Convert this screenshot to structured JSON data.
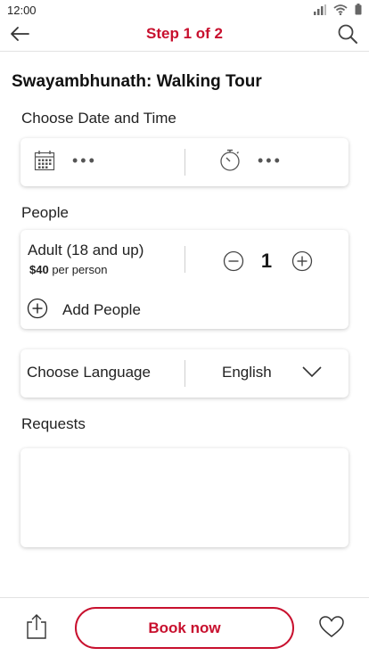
{
  "status_bar": {
    "time": "12:00"
  },
  "header": {
    "title": "Step 1 of 2"
  },
  "tour": {
    "title": "Swayambhunath: Walking Tour"
  },
  "date_time": {
    "label": "Choose Date and Time",
    "date_placeholder": "•••",
    "time_placeholder": "•••"
  },
  "people": {
    "label": "People",
    "adult_label": "Adult (18 and up)",
    "price": "$40",
    "price_suffix": " per person",
    "quantity": "1",
    "add_label": "Add People"
  },
  "language": {
    "label": "Choose Language",
    "value": "English"
  },
  "requests": {
    "label": "Requests",
    "value": ""
  },
  "footer": {
    "book_label": "Book now"
  },
  "colors": {
    "accent": "#c8102e"
  }
}
